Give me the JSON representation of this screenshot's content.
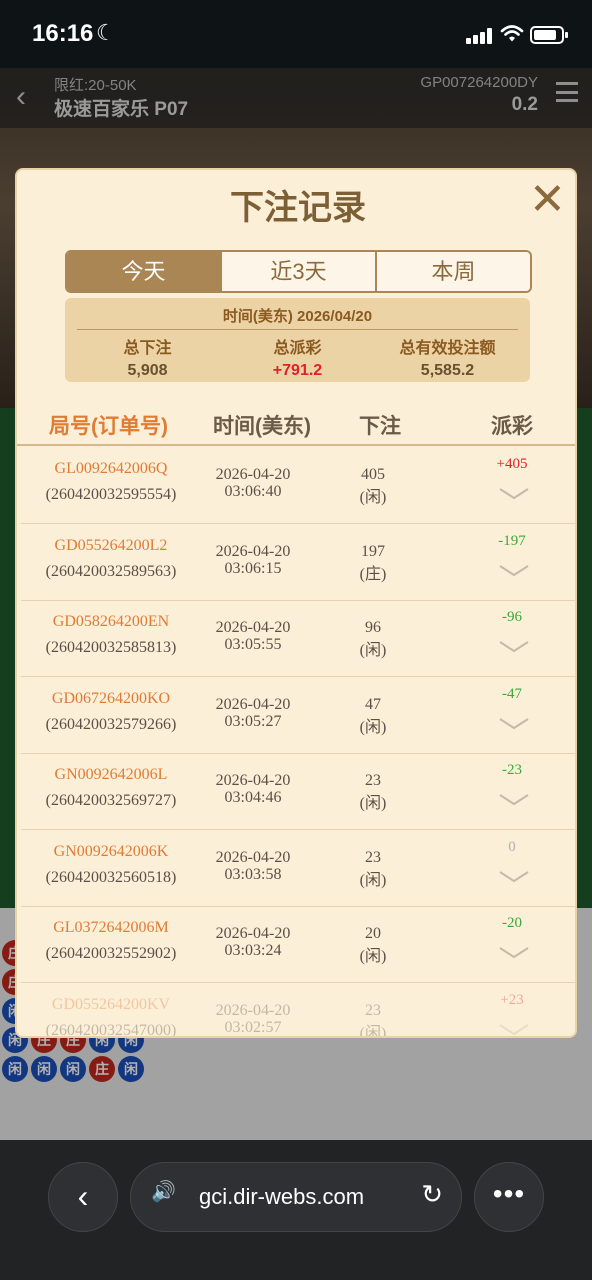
{
  "status_bar": {
    "time": "16:16"
  },
  "game": {
    "limit": "限红:20-50K",
    "table_name": "极速百家乐 P07",
    "game_id": "GP007264200DY",
    "balance": "0.2",
    "beads": [
      [
        "庄",
        "闲",
        "闲",
        "闲",
        "闲"
      ],
      [
        "庄",
        "闲",
        "闲",
        "闲",
        "闲"
      ],
      [
        "闲",
        "庄",
        "和",
        "庄",
        "闲"
      ],
      [
        "闲",
        "庄",
        "庄",
        "闲",
        "闲"
      ],
      [
        "闲",
        "闲",
        "闲",
        "庄",
        "闲"
      ]
    ],
    "bead_colors": {
      "player": "#1b4fb8",
      "banker": "#c0281e",
      "tie": "#2e9a3a"
    }
  },
  "modal": {
    "title": "下注记录",
    "tabs": [
      {
        "label": "今天",
        "active": true
      },
      {
        "label": "近3天",
        "active": false
      },
      {
        "label": "本周",
        "active": false
      }
    ],
    "summary": {
      "date_label": "时间(美东)  2026/04/20",
      "total_bet_label": "总下注",
      "total_bet": "5,908",
      "total_payout_label": "总派彩",
      "total_payout": "+791.2",
      "total_valid_label": "总有效投注额",
      "total_valid": "5,585.2"
    },
    "headers": {
      "round": "局号(订单号)",
      "time": "时间(美东)",
      "bet": "下注",
      "payout": "派彩"
    },
    "rows": [
      {
        "round": "GL0092642006Q",
        "order": "(260420032595554)",
        "date": "2026-04-20",
        "time": "03:06:40",
        "amount": "405",
        "side": "(闲)",
        "payout": "+405",
        "kind": "pos"
      },
      {
        "round": "GD055264200L2",
        "order": "(260420032589563)",
        "date": "2026-04-20",
        "time": "03:06:15",
        "amount": "197",
        "side": "(庄)",
        "payout": "-197",
        "kind": "neg"
      },
      {
        "round": "GD058264200EN",
        "order": "(260420032585813)",
        "date": "2026-04-20",
        "time": "03:05:55",
        "amount": "96",
        "side": "(闲)",
        "payout": "-96",
        "kind": "neg"
      },
      {
        "round": "GD067264200KO",
        "order": "(260420032579266)",
        "date": "2026-04-20",
        "time": "03:05:27",
        "amount": "47",
        "side": "(闲)",
        "payout": "-47",
        "kind": "neg"
      },
      {
        "round": "GN0092642006L",
        "order": "(260420032569727)",
        "date": "2026-04-20",
        "time": "03:04:46",
        "amount": "23",
        "side": "(闲)",
        "payout": "-23",
        "kind": "neg"
      },
      {
        "round": "GN0092642006K",
        "order": "(260420032560518)",
        "date": "2026-04-20",
        "time": "03:03:58",
        "amount": "23",
        "side": "(闲)",
        "payout": "0",
        "kind": "zero"
      },
      {
        "round": "GL0372642006M",
        "order": "(260420032552902)",
        "date": "2026-04-20",
        "time": "03:03:24",
        "amount": "20",
        "side": "(闲)",
        "payout": "-20",
        "kind": "neg"
      },
      {
        "round": "GD055264200KV",
        "order": "(260420032547000)",
        "date": "2026-04-20",
        "time": "03:02:57",
        "amount": "23",
        "side": "(闲)",
        "payout": "+23",
        "kind": "pos"
      }
    ]
  },
  "browser": {
    "url": "gci.dir-webs.com"
  }
}
